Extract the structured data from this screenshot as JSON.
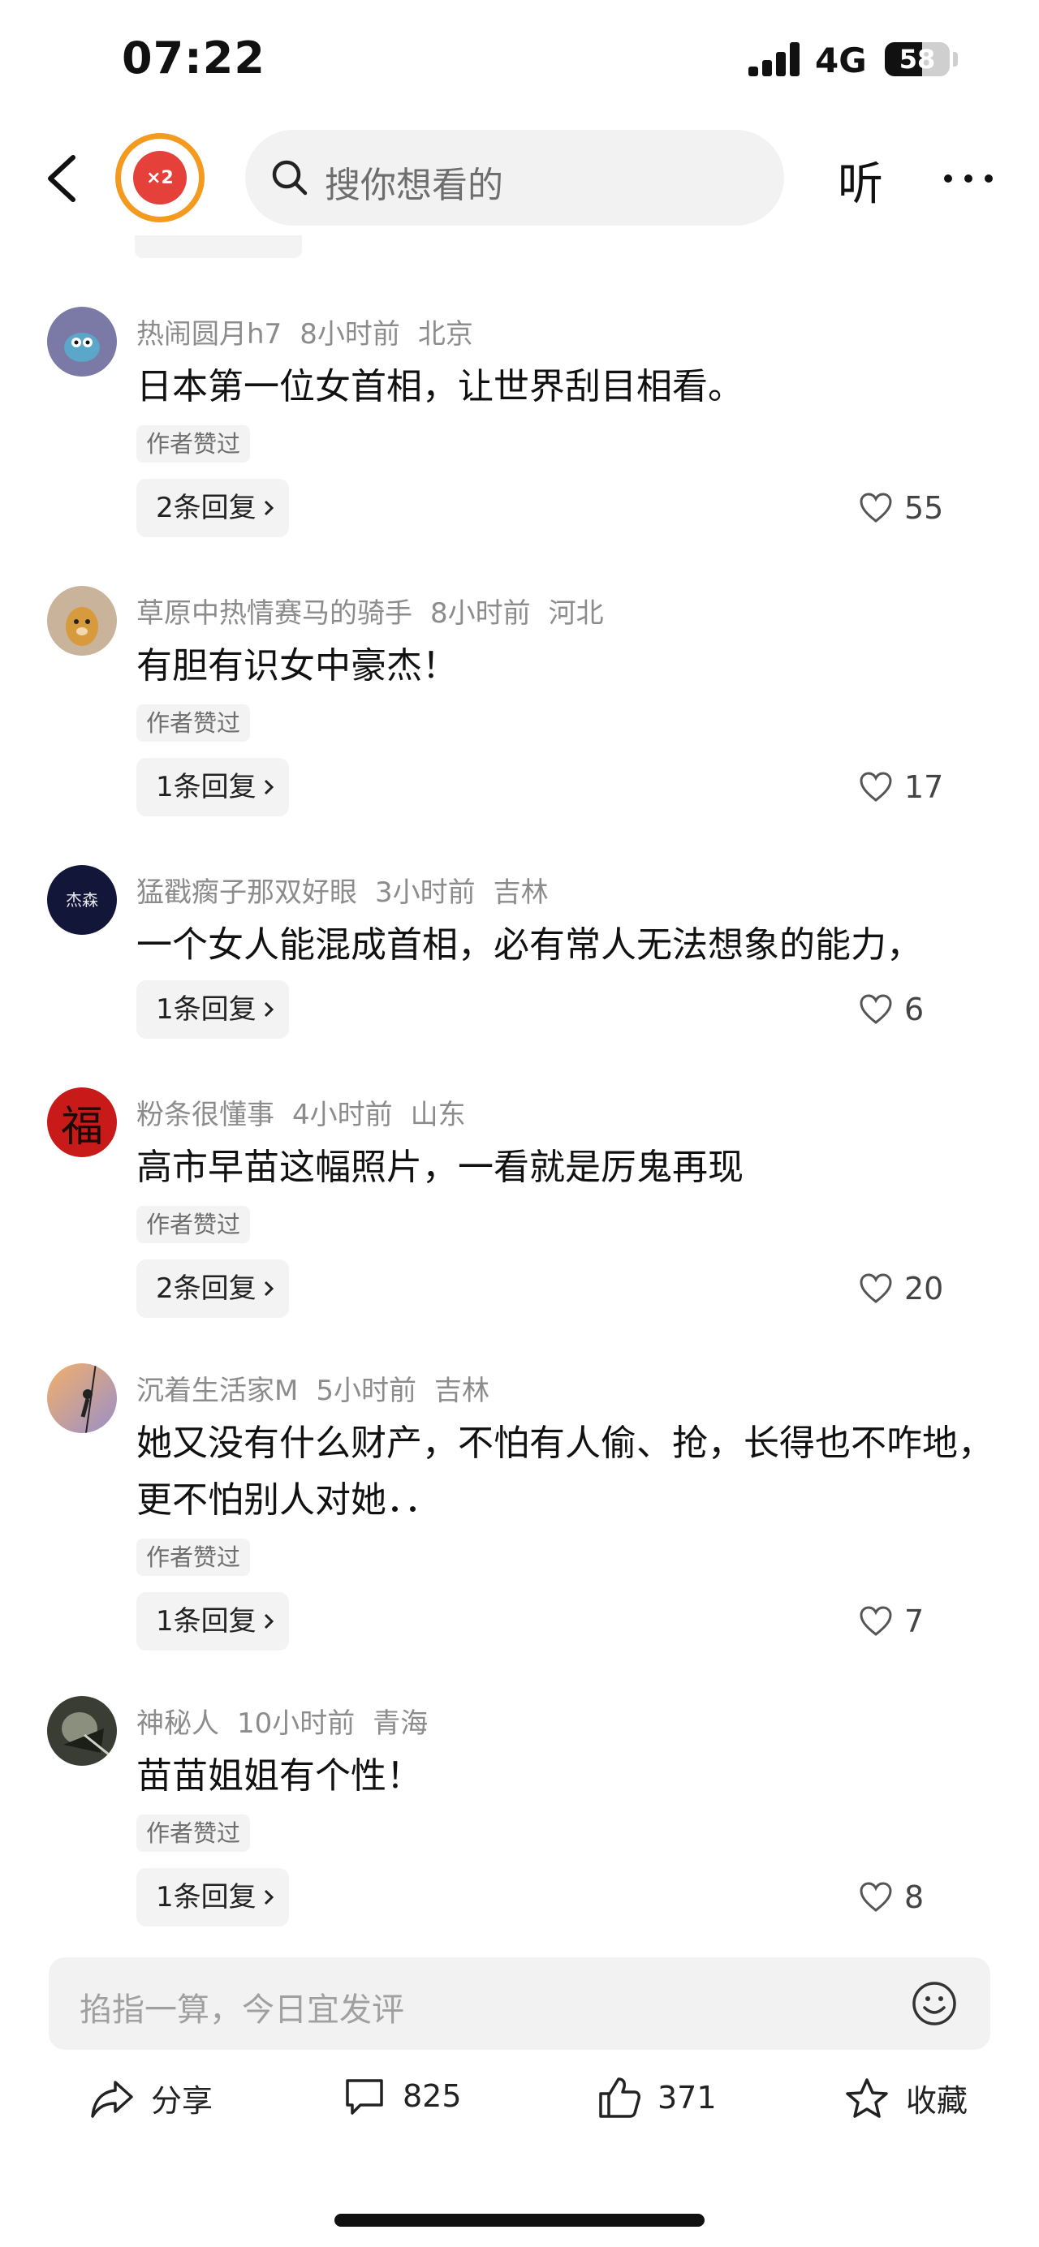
{
  "status_bar": {
    "time": "07:22",
    "network": "4G",
    "battery": "58",
    "battery_level": 0.58
  },
  "header": {
    "badge_text": "×2",
    "search_placeholder": "搜你想看的",
    "listen_label": "听"
  },
  "comments": [
    {
      "user": "热闹圆月h7",
      "time": "8小时前",
      "location": "北京",
      "text": "日本第一位女首相，让世界刮目相看。",
      "author_liked": "作者赞过",
      "replies": "2条回复",
      "likes": "55",
      "avatar_color": "#7b7aa6"
    },
    {
      "user": "草原中热情赛马的骑手",
      "time": "8小时前",
      "location": "河北",
      "text": "有胆有识女中豪杰！",
      "author_liked": "作者赞过",
      "replies": "1条回复",
      "likes": "17",
      "avatar_color": "#c9b39a"
    },
    {
      "user": "猛戳瘸子那双好眼",
      "time": "3小时前",
      "location": "吉林",
      "text": "一个女人能混成首相，必有常人无法想象的能力，",
      "author_liked": "",
      "replies": "1条回复",
      "likes": "6",
      "avatar_color": "#12173a",
      "avatar_text": "杰森"
    },
    {
      "user": "粉条很懂事",
      "time": "4小时前",
      "location": "山东",
      "text": "高市早苗这幅照片，一看就是厉鬼再现",
      "author_liked": "作者赞过",
      "replies": "2条回复",
      "likes": "20",
      "avatar_color": "#c91a1a",
      "avatar_text": "福"
    },
    {
      "user": "沉着生活家M",
      "time": "5小时前",
      "location": "吉林",
      "text": "她又没有什么财产，不怕有人偷、抢，长得也不咋地，更不怕别人对她．．",
      "author_liked": "作者赞过",
      "replies": "1条回复",
      "likes": "7",
      "avatar_color": "#d98a5a"
    },
    {
      "user": "神秘人",
      "time": "10小时前",
      "location": "青海",
      "text": "苗苗姐姐有个性！",
      "author_liked": "作者赞过",
      "replies": "1条回复",
      "likes": "8",
      "avatar_color": "#3a3d34"
    }
  ],
  "input": {
    "placeholder": "掐指一算，今日宜发评"
  },
  "actions": {
    "share": "分享",
    "comments": "825",
    "likes": "371",
    "favorite": "收藏"
  }
}
